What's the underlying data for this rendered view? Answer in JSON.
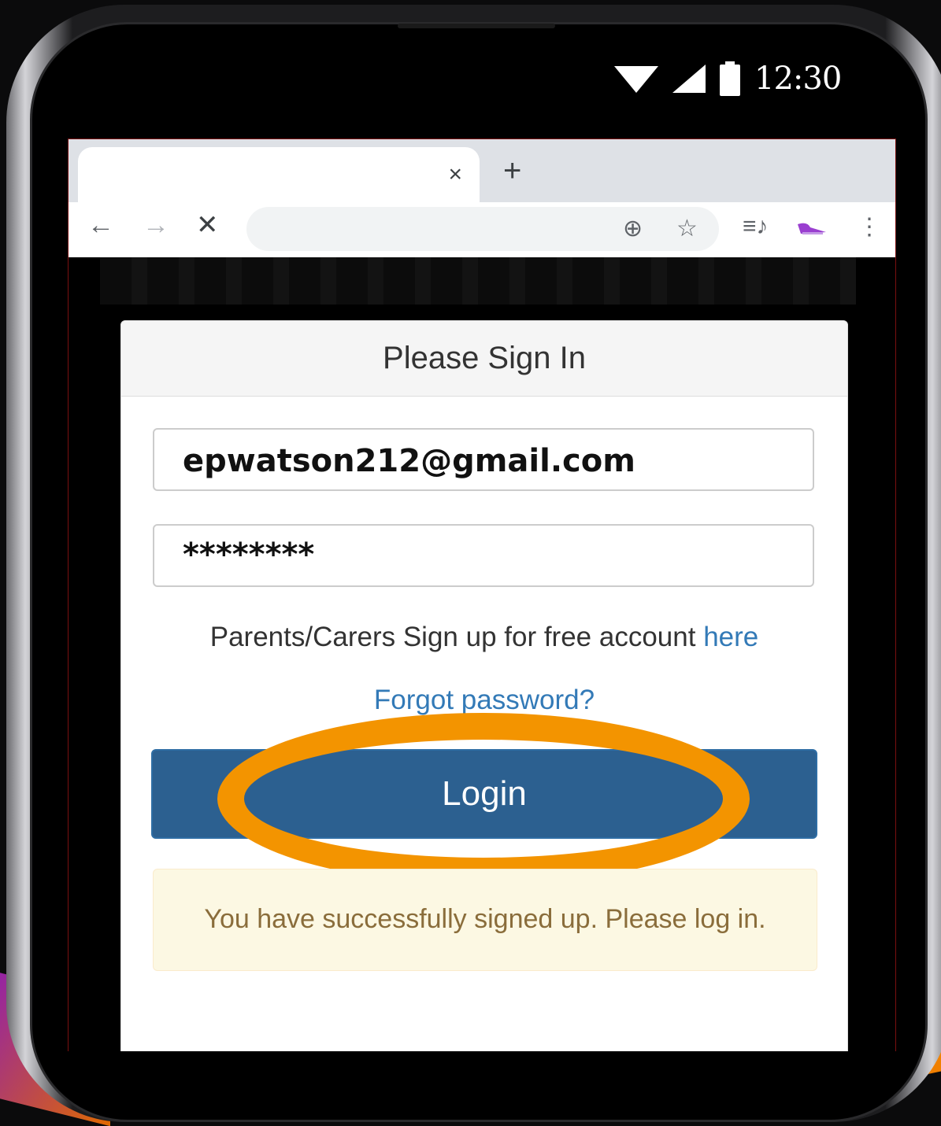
{
  "status_bar": {
    "time": "12:30",
    "wifi_icon": "wifi-icon",
    "signal_icon": "signal-icon",
    "battery_icon": "battery-icon"
  },
  "browser": {
    "tab_close_glyph": "×",
    "new_tab_glyph": "+",
    "back_glyph": "←",
    "forward_glyph": "→",
    "stop_glyph": "✕",
    "zoom_glyph": "⊕",
    "bookmark_glyph": "☆",
    "playlist_glyph": "≡♪",
    "menu_glyph": "⋮"
  },
  "signin": {
    "title": "Please Sign In",
    "email_value": "epwatson212@gmail.com",
    "password_value": "********",
    "signup_text": "Parents/Carers Sign up for free account ",
    "signup_link": "here",
    "forgot_link": "Forgot password?",
    "login_label": "Login",
    "alert_text": "You have successfully signed up. Please log in."
  },
  "colors": {
    "primary_button": "#2c6090",
    "link": "#337ab7",
    "highlight": "#f39400",
    "alert_bg": "#fcf8e3"
  }
}
